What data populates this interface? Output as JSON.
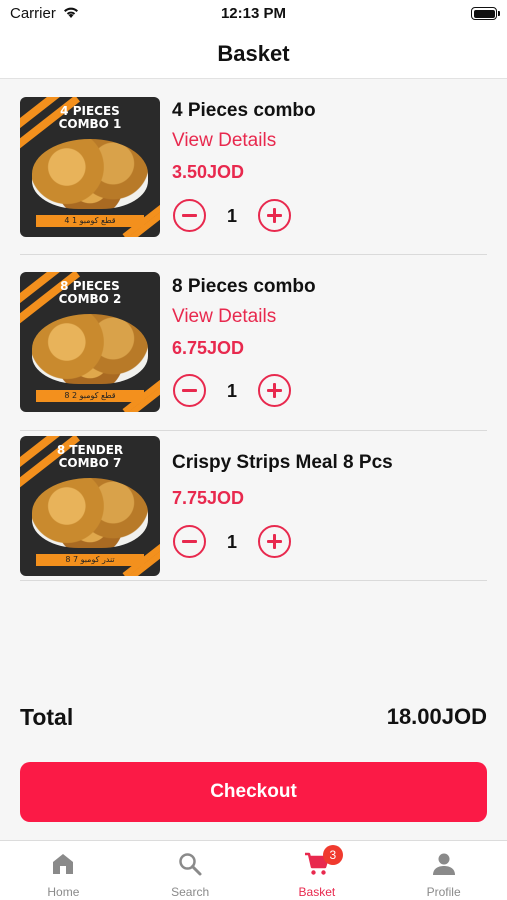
{
  "status_bar": {
    "carrier": "Carrier",
    "time": "12:13 PM"
  },
  "header": {
    "title": "Basket"
  },
  "basket": {
    "items": [
      {
        "name": "4 Pieces combo",
        "details_label": "View Details",
        "price": "3.50JOD",
        "quantity": "1",
        "thumb_caption_line1": "4 PIECES",
        "thumb_caption_line2": "COMBO 1",
        "thumb_band": "4 قطع كومبو 1"
      },
      {
        "name": "8 Pieces combo",
        "details_label": "View Details",
        "price": "6.75JOD",
        "quantity": "1",
        "thumb_caption_line1": "8 PIECES",
        "thumb_caption_line2": "COMBO 2",
        "thumb_band": "8 قطع كومبو 2"
      },
      {
        "name": "Crispy Strips Meal 8 Pcs",
        "price": "7.75JOD",
        "quantity": "1",
        "thumb_caption_line1": "8 TENDER",
        "thumb_caption_line2": "COMBO 7",
        "thumb_band": "8 تندر كومبو 7"
      }
    ]
  },
  "summary": {
    "total_label": "Total",
    "total_value": "18.00JOD"
  },
  "checkout": {
    "label": "Checkout"
  },
  "tabbar": {
    "tabs": [
      {
        "label": "Home",
        "icon": "home-icon"
      },
      {
        "label": "Search",
        "icon": "search-icon"
      },
      {
        "label": "Basket",
        "icon": "cart-icon",
        "badge": "3",
        "active": true
      },
      {
        "label": "Profile",
        "icon": "person-icon"
      }
    ]
  },
  "colors": {
    "accent": "#e8294e",
    "checkout": "#fb1a46",
    "badge": "#f03a2e"
  }
}
